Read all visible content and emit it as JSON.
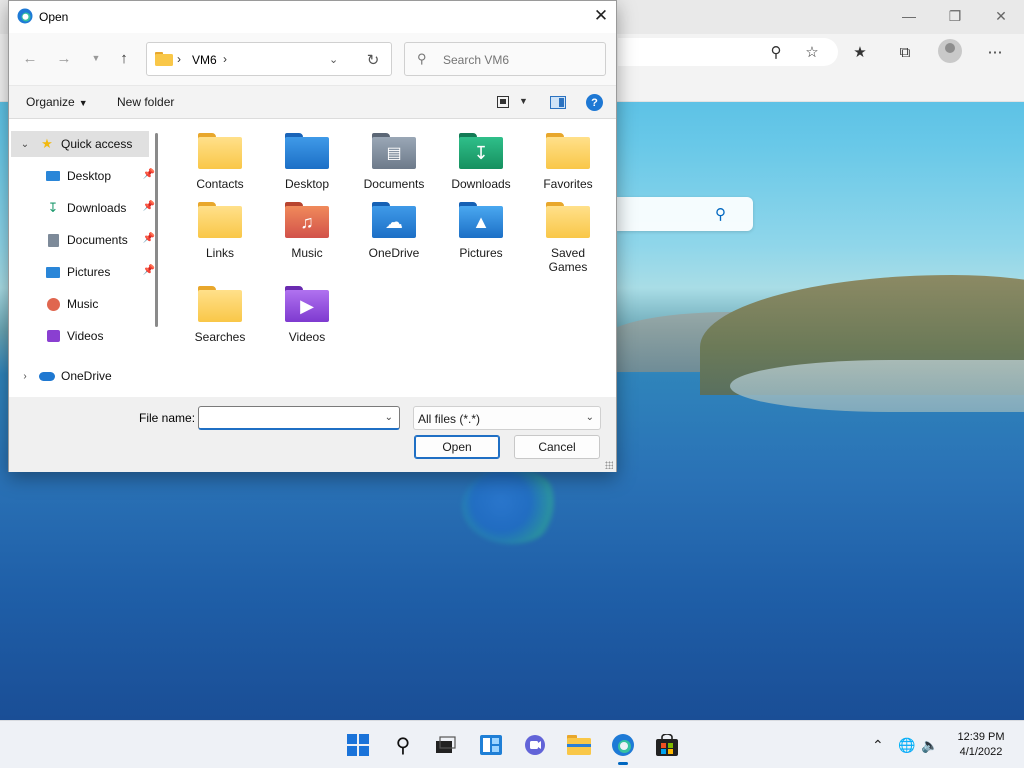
{
  "dialog": {
    "title": "Open",
    "address": {
      "crumb": "VM6"
    },
    "search": {
      "placeholder": "Search VM6"
    },
    "commands": {
      "organize": "Organize",
      "new_folder": "New folder"
    },
    "nav": [
      {
        "label": "Quick access",
        "icon": "star-icon"
      },
      {
        "label": "Desktop",
        "icon": "desktop-icon"
      },
      {
        "label": "Downloads",
        "icon": "download-icon"
      },
      {
        "label": "Documents",
        "icon": "documents-icon"
      },
      {
        "label": "Pictures",
        "icon": "pictures-icon"
      },
      {
        "label": "Music",
        "icon": "music-icon"
      },
      {
        "label": "Videos",
        "icon": "videos-icon"
      },
      {
        "label": "OneDrive",
        "icon": "cloud-icon"
      }
    ],
    "items": [
      {
        "label": "Contacts"
      },
      {
        "label": "Desktop"
      },
      {
        "label": "Documents"
      },
      {
        "label": "Downloads"
      },
      {
        "label": "Favorites"
      },
      {
        "label": "Links"
      },
      {
        "label": "Music"
      },
      {
        "label": "OneDrive"
      },
      {
        "label": "Pictures"
      },
      {
        "label": "Saved Games"
      },
      {
        "label": "Searches"
      },
      {
        "label": "Videos"
      }
    ],
    "filename": {
      "label": "File name:",
      "value": ""
    },
    "filetype": {
      "value": "All files (*.*)"
    },
    "buttons": {
      "open": "Open",
      "cancel": "Cancel"
    }
  },
  "taskbar": {
    "apps": [
      "start-icon",
      "search-icon",
      "task-view-icon",
      "widgets-icon",
      "chat-icon",
      "file-explorer-icon",
      "edge-icon",
      "store-icon"
    ],
    "clock": {
      "time": "12:39 PM",
      "date": "4/1/2022"
    }
  },
  "colors": {
    "accent": "#0067c0",
    "folder": "#f9c748"
  }
}
